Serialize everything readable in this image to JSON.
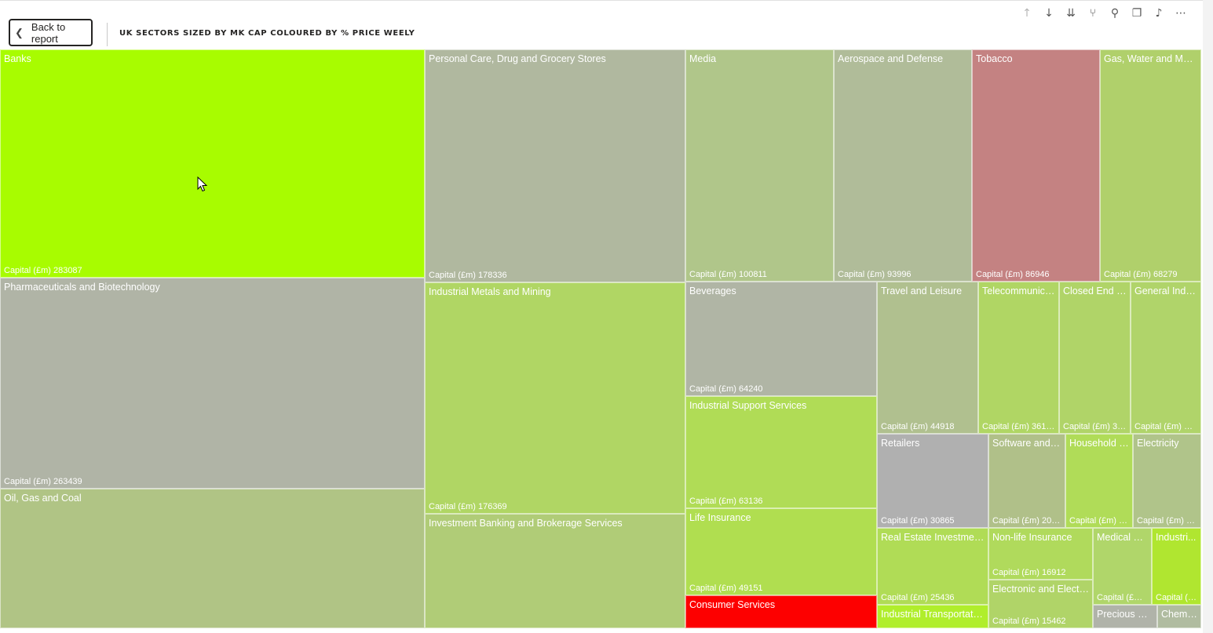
{
  "back_button": {
    "label": "Back to report"
  },
  "visual_title": "UK SECTORS SIZED BY MK CAP COLOURED BY % PRICE WEELY",
  "toolbar": [
    {
      "name": "drill-up-icon",
      "glyph": "↑",
      "dim": true
    },
    {
      "name": "drill-down-icon",
      "glyph": "↓",
      "dim": false
    },
    {
      "name": "expand-all-down-icon",
      "glyph": "⇊",
      "dim": false
    },
    {
      "name": "expand-hierarchy-icon",
      "glyph": "⑂",
      "dim": false
    },
    {
      "name": "pin-icon",
      "glyph": "⚲",
      "dim": false
    },
    {
      "name": "copy-visual-icon",
      "glyph": "❐",
      "dim": false
    },
    {
      "name": "alert-bell-icon",
      "glyph": "♪",
      "dim": false
    },
    {
      "name": "more-options-icon",
      "glyph": "⋯",
      "dim": false
    }
  ],
  "chart_data": {
    "type": "treemap",
    "title": "UK SECTORS SIZED BY MK CAP COLOURED BY % PRICE WEELY",
    "value_label": "Capital (£m)",
    "items": [
      {
        "name": "Banks",
        "label": "Banks",
        "value_text": "Capital (£m) 283087",
        "value": 283087,
        "color": "#a8fc00"
      },
      {
        "name": "Pharmaceuticals and Biotechnology",
        "label": "Pharmaceuticals and Biotechnology",
        "value_text": "Capital (£m) 263439",
        "value": 263439,
        "color": "#b0b4a6"
      },
      {
        "name": "Oil, Gas and Coal",
        "label": "Oil, Gas and Coal",
        "value_text": "",
        "value": null,
        "color": "#b0c485"
      },
      {
        "name": "Personal Care, Drug and Grocery Stores",
        "label": "Personal Care, Drug and Grocery Stores",
        "value_text": "Capital (£m) 178336",
        "value": 178336,
        "color": "#b0b89f"
      },
      {
        "name": "Industrial Metals and Mining",
        "label": "Industrial Metals and Mining",
        "value_text": "Capital (£m) 176369",
        "value": 176369,
        "color": "#b0d664"
      },
      {
        "name": "Investment Banking and Brokerage Services",
        "label": "Investment Banking and Brokerage Services",
        "value_text": "",
        "value": null,
        "color": "#b0cc77"
      },
      {
        "name": "Media",
        "label": "Media",
        "value_text": "Capital (£m) 100811",
        "value": 100811,
        "color": "#b0c68a"
      },
      {
        "name": "Aerospace and Defense",
        "label": "Aerospace and Defense",
        "value_text": "Capital (£m) 93996",
        "value": 93996,
        "color": "#b0bc99"
      },
      {
        "name": "Tobacco",
        "label": "Tobacco",
        "value_text": "Capital (£m) 86946",
        "value": 86946,
        "color": "#c48282"
      },
      {
        "name": "Gas, Water and Multi...",
        "label": "Gas, Water and Multi...",
        "value_text": "Capital (£m) 68279",
        "value": 68279,
        "color": "#b0d06b"
      },
      {
        "name": "Beverages",
        "label": "Beverages",
        "value_text": "Capital (£m) 64240",
        "value": 64240,
        "color": "#b0b5a5"
      },
      {
        "name": "Industrial Support Services",
        "label": "Industrial Support Services",
        "value_text": "Capital (£m) 63136",
        "value": 63136,
        "color": "#b0dc56"
      },
      {
        "name": "Life Insurance",
        "label": "Life Insurance",
        "value_text": "Capital (£m) 49151",
        "value": 49151,
        "color": "#b0de50"
      },
      {
        "name": "Consumer Services",
        "label": "Consumer Services",
        "value_text": "",
        "value": null,
        "color": "#fd0000"
      },
      {
        "name": "Travel and Leisure",
        "label": "Travel and Leisure",
        "value_text": "Capital (£m) 44918",
        "value": 44918,
        "color": "#b0c08f"
      },
      {
        "name": "Telecommunicati...",
        "label": "Telecommunicati...",
        "value_text": "Capital (£m) 36181",
        "value": 36181,
        "color": "#b0d664"
      },
      {
        "name": "Closed End In...",
        "label": "Closed End In...",
        "value_text": "Capital (£m) 31...",
        "value": null,
        "color": "#b0d468"
      },
      {
        "name": "General Indus...",
        "label": "General Indus...",
        "value_text": "Capital (£m) 31...",
        "value": null,
        "color": "#b0d46a"
      },
      {
        "name": "Retailers",
        "label": "Retailers",
        "value_text": "Capital (£m) 30865",
        "value": 30865,
        "color": "#b0b0b0"
      },
      {
        "name": "Software and C...",
        "label": "Software and C...",
        "value_text": "Capital (£m) 20132",
        "value": 20132,
        "color": "#b0c089"
      },
      {
        "name": "Household G...",
        "label": "Household G...",
        "value_text": "Capital (£m) 1...",
        "value": null,
        "color": "#b0dc58"
      },
      {
        "name": "Electricity",
        "label": "Electricity",
        "value_text": "Capital (£m) 1...",
        "value": null,
        "color": "#b0c48a"
      },
      {
        "name": "Real Estate Investment T...",
        "label": "Real Estate Investment T...",
        "value_text": "Capital (£m) 25436",
        "value": 25436,
        "color": "#b0dc56"
      },
      {
        "name": "Industrial Transportation",
        "label": "Industrial Transportation",
        "value_text": "",
        "value": null,
        "color": "#b0ee2c"
      },
      {
        "name": "Non-life Insurance",
        "label": "Non-life Insurance",
        "value_text": "Capital (£m) 16912",
        "value": 16912,
        "color": "#b0da5c"
      },
      {
        "name": "Electronic and Electric...",
        "label": "Electronic and Electric...",
        "value_text": "Capital (£m) 15462",
        "value": 15462,
        "color": "#b0d468"
      },
      {
        "name": "Medical Eq...",
        "label": "Medical Eq...",
        "value_text": "Capital (£m)...",
        "value": null,
        "color": "#b0d66a"
      },
      {
        "name": "Industri...",
        "label": "Industri...",
        "value_text": "Capital (£...",
        "value": null,
        "color": "#b0e630"
      },
      {
        "name": "Precious Me...",
        "label": "Precious Me...",
        "value_text": "",
        "value": null,
        "color": "#b0b3a9"
      },
      {
        "name": "Chemi...",
        "label": "Chemi...",
        "value_text": "",
        "value": null,
        "color": "#b0bca0"
      }
    ]
  }
}
